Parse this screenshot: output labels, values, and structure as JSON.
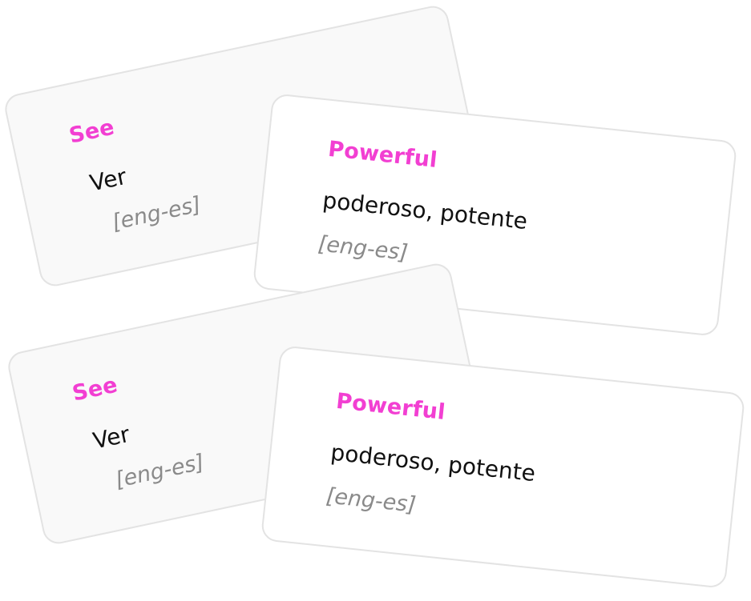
{
  "cards": [
    {
      "word": "See",
      "translation": "Ver",
      "lang": "[eng-es]"
    },
    {
      "word": "Powerful",
      "translation": "poderoso, potente",
      "lang": "[eng-es]"
    },
    {
      "word": "See",
      "translation": "Ver",
      "lang": "[eng-es]"
    },
    {
      "word": "Powerful",
      "translation": "poderoso, potente",
      "lang": "[eng-es]"
    }
  ],
  "colors": {
    "word": "#f23fd2",
    "translation": "#111111",
    "lang": "#8a8a8a",
    "back_card_bg": "#f9f9f9",
    "front_card_bg": "#ffffff",
    "card_border": "#e3e3e3"
  }
}
